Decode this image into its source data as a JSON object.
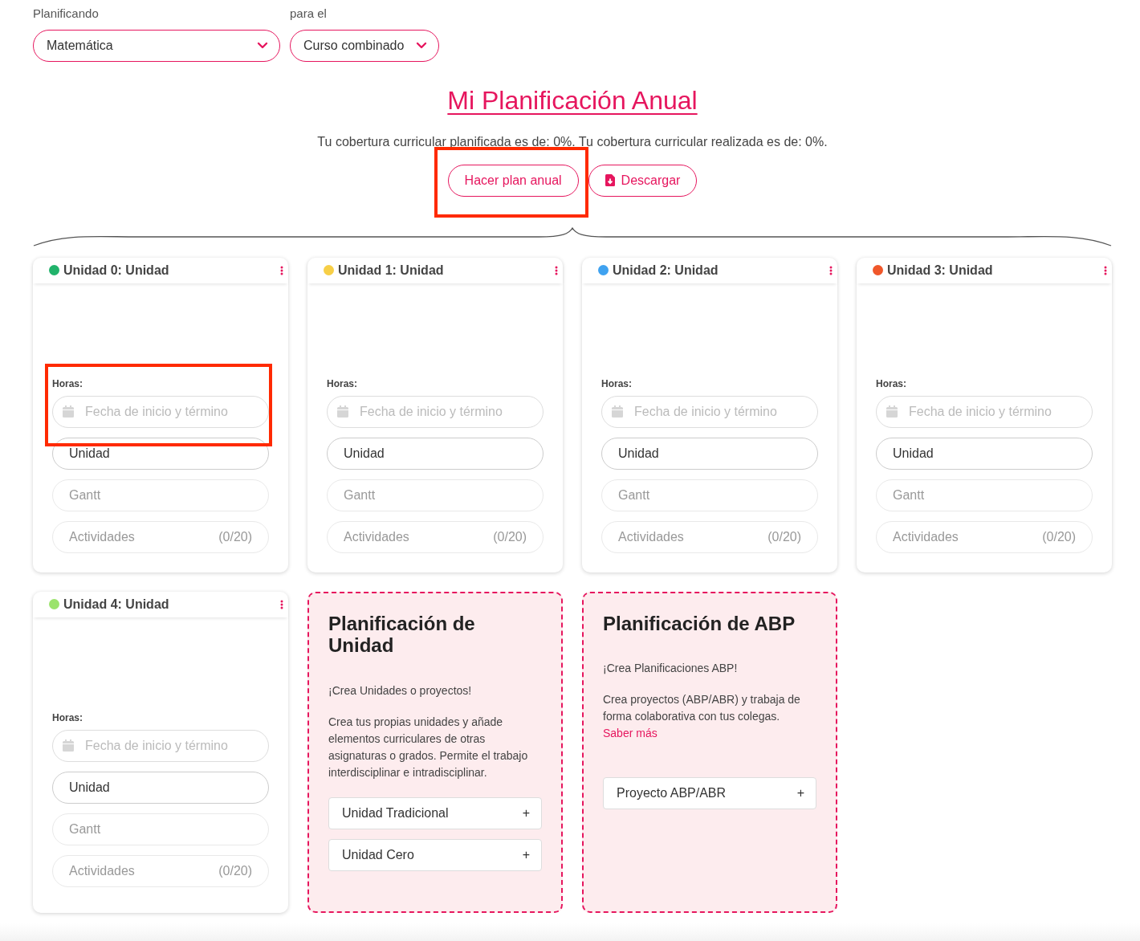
{
  "selectors": [
    {
      "label": "Planificando",
      "value": "Matemática"
    },
    {
      "label": "para el",
      "value": "Curso combinado"
    }
  ],
  "title": "Mi Planificación Anual",
  "coverage": "Tu cobertura curricular planificada es de: 0%. Tu cobertura curricular realizada es de: 0%.",
  "actions": [
    {
      "kind": "plain",
      "label": "Hacer plan anual",
      "highlighted": true
    },
    {
      "kind": "download",
      "label": "Descargar",
      "highlighted": false
    }
  ],
  "units": [
    {
      "title": "Unidad 0: Unidad",
      "color": "#21b36b",
      "hours_label": "Horas:",
      "highlighted": true,
      "fields": [
        {
          "kind": "date",
          "placeholder": "Fecha de inicio y término"
        },
        {
          "kind": "link",
          "label": "Unidad",
          "disabled": false
        },
        {
          "kind": "link",
          "label": "Gantt",
          "disabled": true
        },
        {
          "kind": "link",
          "label": "Actividades",
          "count": "(0/20)",
          "disabled": true
        }
      ]
    },
    {
      "title": "Unidad 1: Unidad",
      "color": "#f7cf47",
      "hours_label": "Horas:",
      "highlighted": false,
      "fields": [
        {
          "kind": "date",
          "placeholder": "Fecha de inicio y término"
        },
        {
          "kind": "link",
          "label": "Unidad",
          "disabled": false
        },
        {
          "kind": "link",
          "label": "Gantt",
          "disabled": true
        },
        {
          "kind": "link",
          "label": "Actividades",
          "count": "(0/20)",
          "disabled": true
        }
      ]
    },
    {
      "title": "Unidad 2: Unidad",
      "color": "#3fa2f0",
      "hours_label": "Horas:",
      "highlighted": false,
      "fields": [
        {
          "kind": "date",
          "placeholder": "Fecha de inicio y término"
        },
        {
          "kind": "link",
          "label": "Unidad",
          "disabled": false
        },
        {
          "kind": "link",
          "label": "Gantt",
          "disabled": true
        },
        {
          "kind": "link",
          "label": "Actividades",
          "count": "(0/20)",
          "disabled": true
        }
      ]
    },
    {
      "title": "Unidad 3: Unidad",
      "color": "#f0572a",
      "hours_label": "Horas:",
      "highlighted": false,
      "fields": [
        {
          "kind": "date",
          "placeholder": "Fecha de inicio y término"
        },
        {
          "kind": "link",
          "label": "Unidad",
          "disabled": false
        },
        {
          "kind": "link",
          "label": "Gantt",
          "disabled": true
        },
        {
          "kind": "link",
          "label": "Actividades",
          "count": "(0/20)",
          "disabled": true
        }
      ]
    },
    {
      "title": "Unidad 4: Unidad",
      "color": "#9be36b",
      "hours_label": "Horas:",
      "highlighted": false,
      "fields": [
        {
          "kind": "date",
          "placeholder": "Fecha de inicio y término"
        },
        {
          "kind": "link",
          "label": "Unidad",
          "disabled": false
        },
        {
          "kind": "link",
          "label": "Gantt",
          "disabled": true
        },
        {
          "kind": "link",
          "label": "Actividades",
          "count": "(0/20)",
          "disabled": true
        }
      ]
    }
  ],
  "promos": [
    {
      "title": "Planificación de Unidad",
      "tagline": "¡Crea Unidades o proyectos!",
      "text": "Crea tus propias unidades y añade elementos curriculares de otras asignaturas o grados. Permite el trabajo interdisciplinar e intradisciplinar.",
      "options": [
        {
          "label": "Unidad Tradicional",
          "icon": "+"
        },
        {
          "label": "Unidad Cero",
          "icon": "+"
        }
      ]
    },
    {
      "title": "Planificación de ABP",
      "tagline": "¡Crea Planificaciones ABP!",
      "text": "Crea proyectos (ABP/ABR) y trabaja de forma colaborativa con tus colegas.",
      "link": "Saber más",
      "options": [
        {
          "label": "Proyecto ABP/ABR",
          "icon": "+"
        }
      ]
    }
  ]
}
